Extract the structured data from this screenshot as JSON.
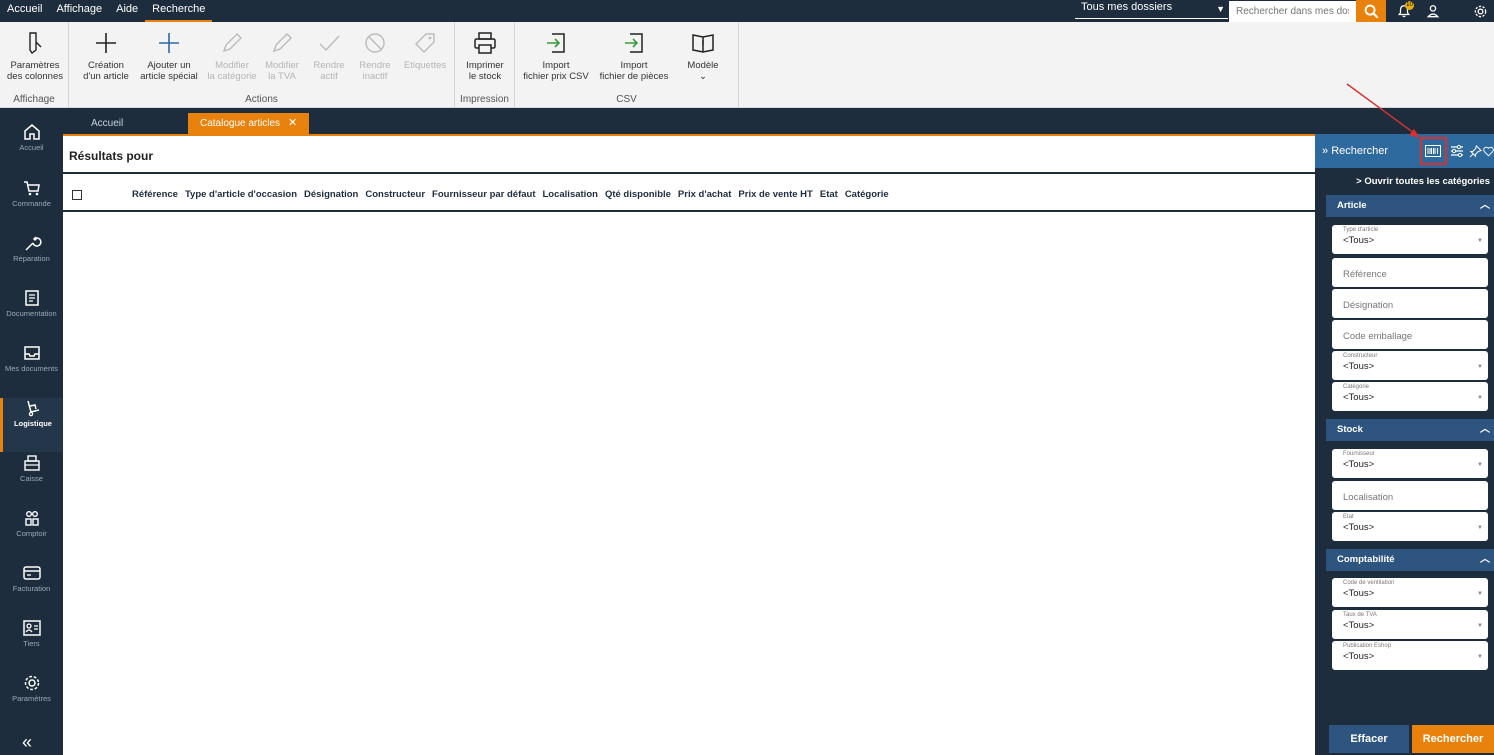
{
  "menu": {
    "items": [
      "Accueil",
      "Affichage",
      "Aide",
      "Recherche"
    ],
    "active": "Recherche"
  },
  "topbar": {
    "folder_select": "Tous mes dossiers",
    "search_placeholder": "Rechercher dans mes dossiers",
    "notification_count": "10"
  },
  "ribbon": {
    "groups": {
      "affichage": "Affichage",
      "actions": "Actions",
      "impression": "Impression",
      "csv": "CSV"
    },
    "buttons": {
      "params_cols": [
        "Paramètres",
        "des colonnes"
      ],
      "creation": [
        "Création",
        "d'un article"
      ],
      "ajouter": [
        "Ajouter un",
        "article spécial"
      ],
      "mod_cat": [
        "Modifier",
        "la catégorie"
      ],
      "mod_tva": [
        "Modifier",
        "la TVA"
      ],
      "rendre_actif": [
        "Rendre",
        "actif"
      ],
      "rendre_inactif": [
        "Rendre",
        "inactif"
      ],
      "etiquettes": [
        "Etiquettes"
      ],
      "imprimer": [
        "Imprimer",
        "le stock"
      ],
      "import_prix": [
        "Import",
        "fichier prix CSV"
      ],
      "import_pieces": [
        "Import",
        "fichier de pièces"
      ],
      "modele": [
        "Modèle"
      ]
    }
  },
  "nav": {
    "items": [
      "Accueil",
      "Commande",
      "Réparation",
      "Documentation",
      "Mes documents",
      "Logistique",
      "Caisse",
      "Comptoir",
      "Facturation",
      "Tiers",
      "Paramètres"
    ],
    "active": "Logistique"
  },
  "tabs": {
    "home": "Accueil",
    "catalogue": "Catalogue articles"
  },
  "main": {
    "title": "Résultats pour",
    "columns": [
      "Référence",
      "Type d'article d'occasion",
      "Désignation",
      "Constructeur",
      "Fournisseur par défaut",
      "Localisation",
      "Qté disponible",
      "Prix d'achat",
      "Prix de vente HT",
      "Etat",
      "Catégorie"
    ]
  },
  "search_panel": {
    "title": "Rechercher",
    "open_all": "Ouvrir toutes les catégories",
    "sections": {
      "article": "Article",
      "stock": "Stock",
      "comptabilite": "Comptabilité"
    },
    "fields": {
      "type_article": {
        "label": "Type d'article",
        "value": "<Tous>"
      },
      "reference": {
        "placeholder": "Référence"
      },
      "designation": {
        "placeholder": "Désignation"
      },
      "code_emballage": {
        "placeholder": "Code emballage"
      },
      "constructeur": {
        "label": "Constructeur",
        "value": "<Tous>"
      },
      "categorie": {
        "label": "Catégorie",
        "value": "<Tous>"
      },
      "fournisseur": {
        "label": "Fournisseur",
        "value": "<Tous>"
      },
      "localisation": {
        "placeholder": "Localisation"
      },
      "etat": {
        "label": "Etat",
        "value": "<Tous>"
      },
      "code_ventilation": {
        "label": "Code de ventilation",
        "value": "<Tous>"
      },
      "taux_tva": {
        "label": "Taux de TVA",
        "value": "<Tous>"
      },
      "publication_eshop": {
        "label": "Publication Eshop",
        "value": "<Tous>"
      }
    },
    "buttons": {
      "clear": "Effacer",
      "search": "Rechercher"
    }
  },
  "colors": {
    "dark": "#1e2d3d",
    "accent": "#e8820c",
    "panel_header": "#2e6a9e",
    "section": "#2e5580",
    "highlight": "#d93030"
  }
}
